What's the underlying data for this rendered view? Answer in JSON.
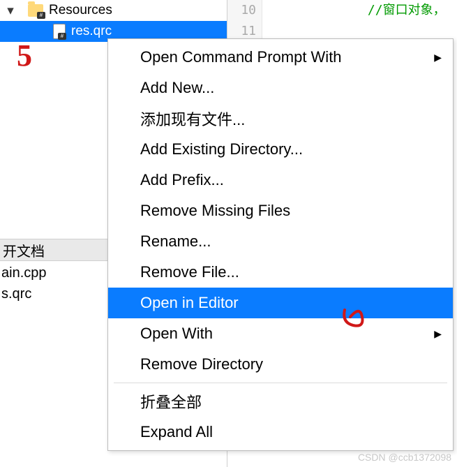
{
  "tree": {
    "folder_label": "Resources",
    "file_label": "res.qrc"
  },
  "open_docs": {
    "header": "开文档",
    "items": [
      "ain.cpp",
      "s.qrc"
    ]
  },
  "editor": {
    "line_numbers": [
      "10",
      "11"
    ],
    "line1_comment": "//窗口对象，",
    "line2_partial": ""
  },
  "menu": {
    "items": [
      {
        "label": "Open Command Prompt With",
        "submenu": true
      },
      {
        "label": "Add New..."
      },
      {
        "label": "添加现有文件..."
      },
      {
        "label": "Add Existing Directory..."
      },
      {
        "label": "Add Prefix..."
      },
      {
        "label": "Remove Missing Files"
      },
      {
        "label": "Rename..."
      },
      {
        "label": "Remove File..."
      },
      {
        "label": "Open in Editor",
        "highlighted": true
      },
      {
        "label": "Open With",
        "submenu": true
      },
      {
        "label": "Remove Directory"
      },
      {
        "sep": true
      },
      {
        "label": "折叠全部"
      },
      {
        "label": "Expand All"
      }
    ]
  },
  "annotations": {
    "mark5": "5",
    "mark6": "6"
  },
  "watermark": "CSDN @ccb1372098"
}
